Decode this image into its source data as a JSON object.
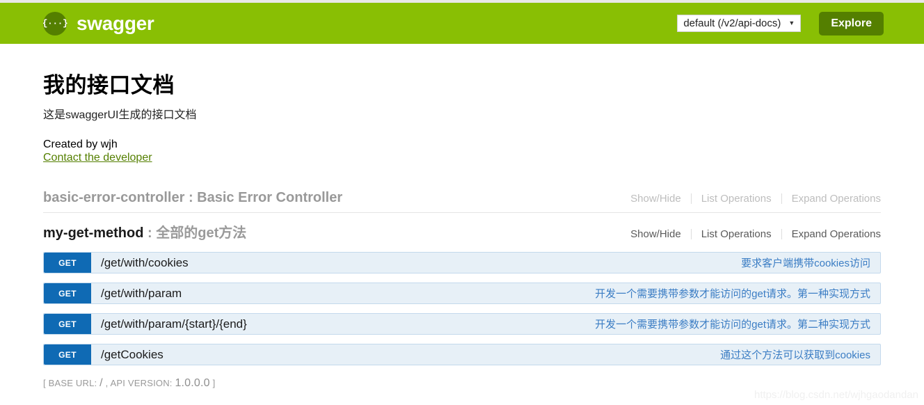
{
  "header": {
    "brand_icon": "braces-icon",
    "brand_name": "swagger",
    "api_select_value": "default (/v2/api-docs)",
    "api_select_caret": "▼",
    "explore_label": "Explore"
  },
  "info": {
    "title": "我的接口文档",
    "description": "这是swaggerUI生成的接口文档",
    "created_by": "Created by wjh",
    "contact_link": "Contact the developer"
  },
  "resources": [
    {
      "name": "basic-error-controller",
      "separator": " : ",
      "summary": "Basic Error Controller",
      "options": {
        "show_hide": "Show/Hide",
        "list_operations": "List Operations",
        "expand_operations": "Expand Operations"
      }
    },
    {
      "name": "my-get-method",
      "separator": " : ",
      "summary": "全部的get方法",
      "options": {
        "show_hide": "Show/Hide",
        "list_operations": "List Operations",
        "expand_operations": "Expand Operations"
      }
    }
  ],
  "endpoints": [
    {
      "method": "GET",
      "path": "/get/with/cookies",
      "summary": "要求客户端携带cookies访问"
    },
    {
      "method": "GET",
      "path": "/get/with/param",
      "summary": "开发一个需要携带参数才能访问的get请求。第一种实现方式"
    },
    {
      "method": "GET",
      "path": "/get/with/param/{start}/{end}",
      "summary": "开发一个需要携带参数才能访问的get请求。第二种实现方式"
    },
    {
      "method": "GET",
      "path": "/getCookies",
      "summary": "通过这个方法可以获取到cookies"
    }
  ],
  "footer": {
    "open_bracket": "[ ",
    "base_url_label": "BASE URL: ",
    "base_url_value": "/",
    "comma": " , ",
    "api_version_label": "API VERSION: ",
    "api_version_value": "1.0.0.0",
    "close_bracket": " ]"
  },
  "watermark": "https://blog.csdn.net/wjhgaodandan",
  "colors": {
    "brand_green": "#89bf04",
    "dark_green": "#547f00",
    "method_get_blue": "#0f6ab4",
    "endpoint_bg": "#e7f0f7",
    "summary_blue": "#3b7dc4"
  }
}
